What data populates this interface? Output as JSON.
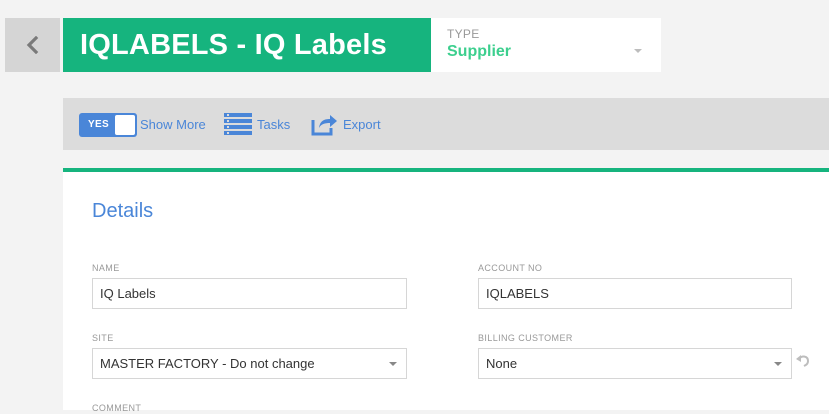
{
  "header": {
    "title": "IQLABELS - IQ Labels",
    "type_label": "TYPE",
    "type_value": "Supplier"
  },
  "toolbar": {
    "toggle_label": "YES",
    "show_more_label": "Show More",
    "tasks_label": "Tasks",
    "export_label": "Export"
  },
  "details": {
    "section_title": "Details",
    "fields": {
      "name": {
        "label": "NAME",
        "value": "IQ Labels"
      },
      "account_no": {
        "label": "ACCOUNT NO",
        "value": "IQLABELS"
      },
      "site": {
        "label": "SITE",
        "value": "MASTER FACTORY - Do not change"
      },
      "billing_customer": {
        "label": "BILLING CUSTOMER",
        "value": "None"
      },
      "comment": {
        "label": "COMMENT"
      }
    }
  },
  "icons": {
    "back": "chevron-left-icon",
    "tasks": "tasks-list-icon",
    "export": "export-share-icon",
    "dropdown": "caret-down-icon",
    "reset": "undo-icon"
  },
  "colors": {
    "brand_green": "#16b47e",
    "type_green": "#3ccf8e",
    "accent_blue": "#4a86d8",
    "toolbar_bg": "#dcdcdc",
    "page_bg": "#f3f3f3"
  }
}
